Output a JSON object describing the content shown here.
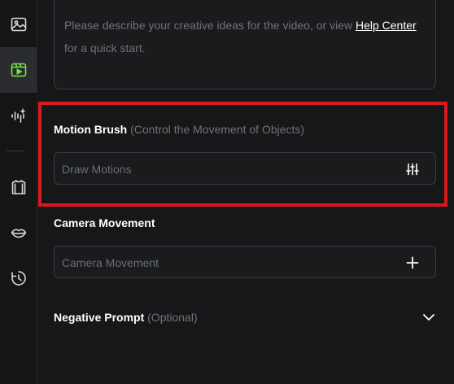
{
  "sidebar": {
    "items": [
      {
        "icon": "image-icon"
      },
      {
        "icon": "video-play-icon",
        "active": true
      },
      {
        "icon": "audio-wave-sparkle-icon"
      },
      {
        "icon": "shirt-icon"
      },
      {
        "icon": "lips-icon"
      },
      {
        "icon": "history-clock-icon"
      }
    ]
  },
  "prompt": {
    "text_before": "Please describe your creative ideas for the video, or view ",
    "link": "Help Center",
    "text_after": "for a quick start."
  },
  "motion_brush": {
    "title": "Motion Brush",
    "subtitle": "(Control the Movement of Objects)",
    "placeholder": "Draw Motions",
    "icon": "sliders-icon"
  },
  "camera": {
    "title": "Camera Movement",
    "placeholder": "Camera Movement",
    "icon": "plus-icon"
  },
  "negative": {
    "title": "Negative Prompt",
    "subtitle": "(Optional)",
    "icon": "chevron-down-icon"
  },
  "colors": {
    "accent": "#7ee24a",
    "highlight": "#d9191f"
  }
}
